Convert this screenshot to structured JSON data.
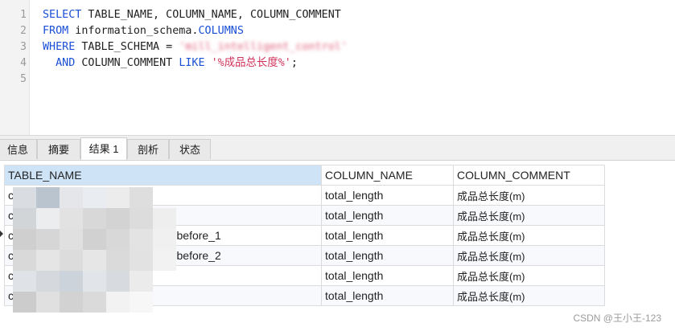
{
  "editor": {
    "line_numbers": [
      "1",
      "2",
      "3",
      "4",
      "5"
    ],
    "line1": {
      "kw1": "SELECT",
      "rest": " TABLE_NAME, COLUMN_NAME, COLUMN_COMMENT"
    },
    "line2": {
      "kw1": "FROM",
      "mid": " information_schema.",
      "kw2": "COLUMNS"
    },
    "line3": {
      "kw1": "WHERE",
      "mid": " TABLE_SCHEMA = ",
      "str": "'mill_intelligent_control'"
    },
    "line4": {
      "indent": "  ",
      "kw1": "AND",
      "mid": " COLUMN_COMMENT ",
      "kw2": "LIKE",
      "sp": " ",
      "str": "'%成品总长度%'",
      "end": ";"
    }
  },
  "tabs": [
    {
      "label": "信息"
    },
    {
      "label": "摘要"
    },
    {
      "label": "结果 1"
    },
    {
      "label": "剖析"
    },
    {
      "label": "状态"
    }
  ],
  "active_tab": "结果 1",
  "grid": {
    "headers": [
      "TABLE_NAME",
      "COLUMN_NAME",
      "COLUMN_COMMENT"
    ],
    "rows": [
      {
        "table": "c",
        "column": "total_length",
        "comment": "成品总长度(m)"
      },
      {
        "table": "c",
        "column": "total_length",
        "comment": "成品总长度(m)"
      },
      {
        "table": "c",
        "suffix": "before_1",
        "column": "total_length",
        "comment": "成品总长度(m)"
      },
      {
        "table": "c",
        "suffix": "before_2",
        "column": "total_length",
        "comment": "成品总长度(m)"
      },
      {
        "table": "c",
        "column": "total_length",
        "comment": "成品总长度(m)"
      },
      {
        "table": "c",
        "column": "total_length",
        "comment": "成品总长度(m)"
      }
    ]
  },
  "watermark": "CSDN @王小王-123"
}
